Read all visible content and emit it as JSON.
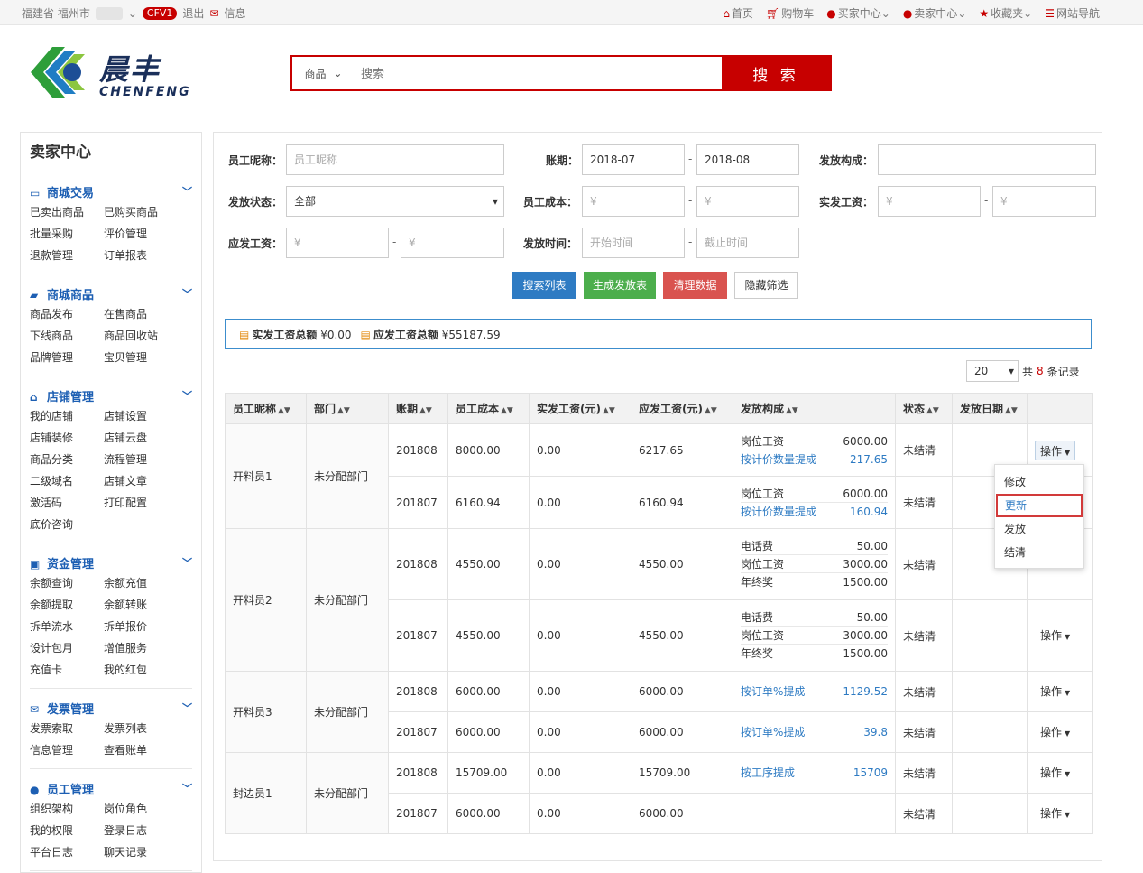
{
  "topbar": {
    "location": "福建省 福州市",
    "badge": "CFV1",
    "logout": "退出",
    "messages": "信息",
    "links": [
      "首页",
      "购物车",
      "买家中心",
      "卖家中心",
      "收藏夹",
      "网站导航"
    ]
  },
  "brand": {
    "name_cn": "晨丰",
    "name_en": "CHENFENG"
  },
  "search": {
    "category": "商品",
    "placeholder": "搜索",
    "button": "搜 索"
  },
  "sidebar": {
    "title": "卖家中心",
    "groups": [
      {
        "title": "商城交易",
        "icon": "card-icon",
        "items": [
          "已卖出商品",
          "已购买商品",
          "批量采购",
          "评价管理",
          "退款管理",
          "订单报表"
        ]
      },
      {
        "title": "商城商品",
        "icon": "truck-icon",
        "items": [
          "商品发布",
          "在售商品",
          "下线商品",
          "商品回收站",
          "品牌管理",
          "宝贝管理"
        ]
      },
      {
        "title": "店铺管理",
        "icon": "home-icon",
        "items": [
          "我的店铺",
          "店铺设置",
          "店铺装修",
          "店铺云盘",
          "商品分类",
          "流程管理",
          "二级域名",
          "店铺文章",
          "激活码",
          "打印配置",
          "底价咨询"
        ]
      },
      {
        "title": "资金管理",
        "icon": "money-icon",
        "items": [
          "余额查询",
          "余额充值",
          "余额提取",
          "余额转账",
          "拆单流水",
          "拆单报价",
          "设计包月",
          "增值服务",
          "充值卡",
          "我的红包"
        ]
      },
      {
        "title": "发票管理",
        "icon": "envelope-icon",
        "items": [
          "发票索取",
          "发票列表",
          "信息管理",
          "查看账单"
        ]
      },
      {
        "title": "员工管理",
        "icon": "users-icon",
        "items": [
          "组织架构",
          "岗位角色",
          "我的权限",
          "登录日志",
          "平台日志",
          "聊天记录"
        ]
      }
    ]
  },
  "filters": {
    "nickname_label": "员工昵称：",
    "nickname_placeholder": "员工昵称",
    "period_label": "账期：",
    "period_from": "2018-07",
    "period_to": "2018-08",
    "composition_label": "发放构成：",
    "status_label": "发放状态：",
    "status_value": "全部",
    "cost_label": "员工成本：",
    "paid_label": "实发工资：",
    "due_label": "应发工资：",
    "time_label": "发放时间：",
    "time_from": "开始时间",
    "time_to": "截止时间",
    "currency": "¥",
    "dash": "-"
  },
  "actions": {
    "search": "搜索列表",
    "generate": "生成发放表",
    "clear": "清理数据",
    "hide": "隐藏筛选"
  },
  "summary": {
    "paid_label": "实发工资总额",
    "paid_value": "¥0.00",
    "due_label": "应发工资总额",
    "due_value": "¥55187.59"
  },
  "pager": {
    "page_size": "20",
    "prefix": "共",
    "count": "8",
    "suffix": "条记录"
  },
  "table": {
    "headers": [
      "员工昵称",
      "部门",
      "账期",
      "员工成本",
      "实发工资(元)",
      "应发工资(元)",
      "发放构成",
      "状态",
      "发放日期",
      ""
    ],
    "groups": [
      {
        "name": "开料员1",
        "dept": "未分配部门",
        "rows": [
          {
            "period": "201808",
            "cost": "8000.00",
            "paid": "0.00",
            "due": "6217.65",
            "items": [
              {
                "label": "岗位工资",
                "value": "6000.00",
                "link": false
              },
              {
                "label": "按计价数量提成",
                "value": "217.65",
                "link": true
              }
            ],
            "status": "未结清",
            "date": "",
            "op": "操作"
          },
          {
            "period": "201807",
            "cost": "6160.94",
            "paid": "0.00",
            "due": "6160.94",
            "items": [
              {
                "label": "岗位工资",
                "value": "6000.00",
                "link": false
              },
              {
                "label": "按计价数量提成",
                "value": "160.94",
                "link": true
              }
            ],
            "status": "未结清",
            "date": "",
            "op": ""
          }
        ]
      },
      {
        "name": "开料员2",
        "dept": "未分配部门",
        "rows": [
          {
            "period": "201808",
            "cost": "4550.00",
            "paid": "0.00",
            "due": "4550.00",
            "items": [
              {
                "label": "电话费",
                "value": "50.00",
                "link": false
              },
              {
                "label": "岗位工资",
                "value": "3000.00",
                "link": false
              },
              {
                "label": "年终奖",
                "value": "1500.00",
                "link": false
              }
            ],
            "status": "未结清",
            "date": "",
            "op": ""
          },
          {
            "period": "201807",
            "cost": "4550.00",
            "paid": "0.00",
            "due": "4550.00",
            "items": [
              {
                "label": "电话费",
                "value": "50.00",
                "link": false
              },
              {
                "label": "岗位工资",
                "value": "3000.00",
                "link": false
              },
              {
                "label": "年终奖",
                "value": "1500.00",
                "link": false
              }
            ],
            "status": "未结清",
            "date": "",
            "op": "操作"
          }
        ]
      },
      {
        "name": "开料员3",
        "dept": "未分配部门",
        "rows": [
          {
            "period": "201808",
            "cost": "6000.00",
            "paid": "0.00",
            "due": "6000.00",
            "items": [
              {
                "label": "按订单%提成",
                "value": "1129.52",
                "link": true
              }
            ],
            "status": "未结清",
            "date": "",
            "op": "操作"
          },
          {
            "period": "201807",
            "cost": "6000.00",
            "paid": "0.00",
            "due": "6000.00",
            "items": [
              {
                "label": "按订单%提成",
                "value": "39.8",
                "link": true
              }
            ],
            "status": "未结清",
            "date": "",
            "op": "操作"
          }
        ]
      },
      {
        "name": "封边员1",
        "dept": "未分配部门",
        "rows": [
          {
            "period": "201808",
            "cost": "15709.00",
            "paid": "0.00",
            "due": "15709.00",
            "items": [
              {
                "label": "按工序提成",
                "value": "15709",
                "link": true
              }
            ],
            "status": "未结清",
            "date": "",
            "op": "操作"
          },
          {
            "period": "201807",
            "cost": "6000.00",
            "paid": "0.00",
            "due": "6000.00",
            "items": [],
            "status": "未结清",
            "date": "",
            "op": "操作"
          }
        ]
      }
    ]
  },
  "dropdown": {
    "items": [
      "修改",
      "更新",
      "发放",
      "结清"
    ]
  }
}
